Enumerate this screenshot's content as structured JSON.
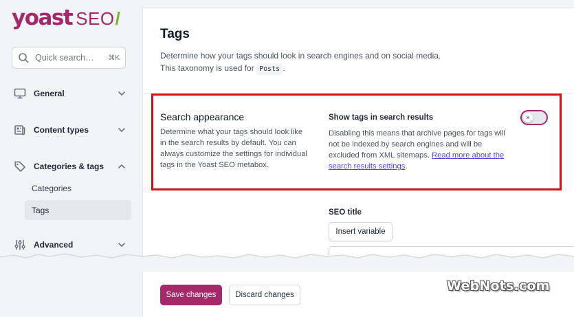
{
  "brand": {
    "yoast": "yoast",
    "seo": "SEO",
    "slash": "/",
    "colors": {
      "primary": "#a4286a",
      "accent_green": "#77b227",
      "highlight_red": "#d1111a"
    }
  },
  "search": {
    "placeholder": "Quick search…",
    "shortcut": "⌘K"
  },
  "sidebar": {
    "items": [
      {
        "label": "General",
        "icon": "desktop-icon",
        "expanded": false
      },
      {
        "label": "Content types",
        "icon": "newspaper-icon",
        "expanded": false
      },
      {
        "label": "Categories & tags",
        "icon": "tag-icon",
        "expanded": true,
        "children": [
          {
            "label": "Categories",
            "active": false
          },
          {
            "label": "Tags",
            "active": true
          }
        ]
      },
      {
        "label": "Advanced",
        "icon": "adjustments-icon",
        "expanded": false
      }
    ]
  },
  "main": {
    "title": "Tags",
    "description_line1": "Determine how your tags should look in search engines and on social media.",
    "description_line2_prefix": "This taxonomy is used for",
    "description_code": "Posts",
    "description_suffix": ".",
    "section": {
      "title": "Search appearance",
      "description": "Determine what your tags should look like in the search results by default. You can always customize the settings for individual tags in the Yoast SEO metabox."
    },
    "toggle_field": {
      "label": "Show tags in search results",
      "description": "Disabling this means that archive pages for tags will not be indexed by search engines and will be excluded from XML sitemaps.",
      "link_text": "Read more about the search results settings",
      "link_suffix": ".",
      "enabled": false,
      "knob_glyph": "×"
    },
    "seo_title": {
      "label": "SEO title",
      "insert_variable": "Insert variable"
    }
  },
  "footer": {
    "save": "Save changes",
    "discard": "Discard changes"
  },
  "watermark": "WebNots.com"
}
